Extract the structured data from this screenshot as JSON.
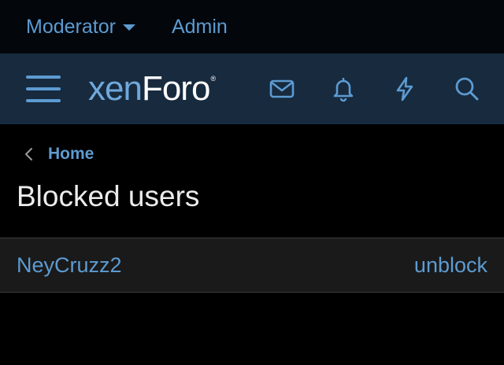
{
  "staff_bar": {
    "moderator_label": "Moderator",
    "admin_label": "Admin"
  },
  "navbar": {
    "logo_xen": "xen",
    "logo_foro": "Foro",
    "logo_reg": "®",
    "icons": [
      "menu-icon",
      "envelope-icon",
      "bell-icon",
      "lightning-icon",
      "search-icon"
    ]
  },
  "breadcrumb": {
    "home_label": "Home"
  },
  "page": {
    "title": "Blocked users"
  },
  "blocked_users": [
    {
      "username": "NeyCruzz2",
      "action_label": "unblock"
    }
  ],
  "colors": {
    "accent": "#5d9bd1",
    "navbar_bg": "#172a3e",
    "staff_bar_bg": "#03070c",
    "row_bg": "#1a1a1a",
    "page_bg": "#000000"
  }
}
